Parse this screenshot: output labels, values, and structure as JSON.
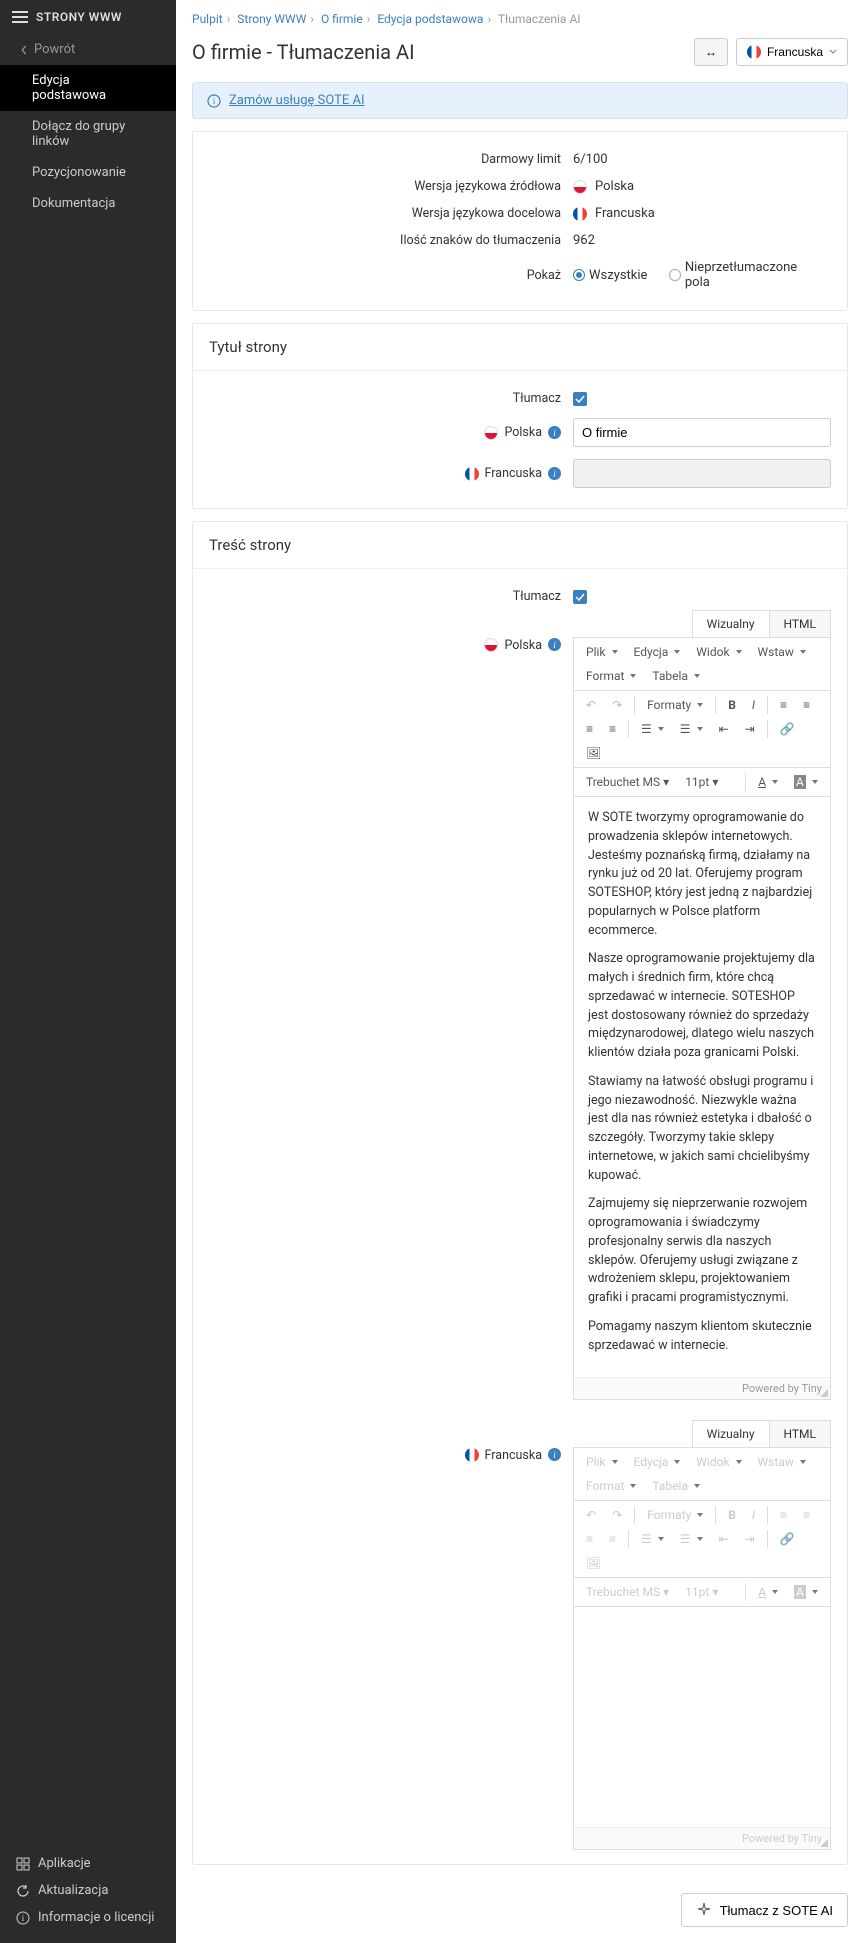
{
  "sidebar": {
    "title": "STRONY WWW",
    "back": "Powrót",
    "items": [
      {
        "label": "Edycja podstawowa",
        "active": true
      },
      {
        "label": "Dołącz do grupy linków"
      },
      {
        "label": "Pozycjonowanie"
      },
      {
        "label": "Dokumentacja"
      }
    ],
    "footer": [
      {
        "label": "Aplikacje"
      },
      {
        "label": "Aktualizacja"
      },
      {
        "label": "Informacje o licencji"
      }
    ]
  },
  "breadcrumb": {
    "items": [
      "Pulpit",
      "Strony WWW",
      "O firmie",
      "Edycja podstawowa"
    ],
    "current": "Tłumaczenia AI"
  },
  "page": {
    "title": "O firmie - Tłumaczenia AI",
    "swap_icon": "↔",
    "lang_selected": "Francuska"
  },
  "banner": {
    "text": "Zamów usługę SOTE AI"
  },
  "summary": {
    "free_limit_label": "Darmowy limit",
    "free_limit_value": "6/100",
    "source_label": "Wersja językowa źródłowa",
    "source_value": "Polska",
    "target_label": "Wersja językowa docelowa",
    "target_value": "Francuska",
    "chars_label": "Ilość znaków do tłumaczenia",
    "chars_value": "962",
    "show_label": "Pokaż",
    "radio_all": "Wszystkie",
    "radio_untranslated": "Nieprzetłumaczone pola"
  },
  "title_section": {
    "heading": "Tytuł strony",
    "translate_label": "Tłumacz",
    "polska_label": "Polska",
    "polska_value": "O firmie",
    "francuska_label": "Francuska",
    "francuska_value": ""
  },
  "content_section": {
    "heading": "Treść strony",
    "translate_label": "Tłumacz",
    "polska_label": "Polska",
    "francuska_label": "Francuska",
    "tabs": {
      "visual": "Wizualny",
      "html": "HTML"
    },
    "toolbar": {
      "file": "Plik",
      "edit": "Edycja",
      "view": "Widok",
      "insert": "Wstaw",
      "format": "Format",
      "table": "Tabela",
      "formats": "Formaty",
      "font": "Trebuchet MS",
      "size": "11pt"
    },
    "content_pl": [
      "W SOTE tworzymy oprogramowanie do prowadzenia sklepów internetowych. Jesteśmy poznańską firmą, działamy na rynku już od 20 lat. Oferujemy program SOTESHOP, który jest jedną z najbardziej popularnych w Polsce platform ecommerce.",
      "Nasze oprogramowanie projektujemy dla małych i średnich firm, które chcą sprzedawać w internecie. SOTESHOP jest dostosowany również do sprzedaży międzynarodowej, dlatego wielu naszych klientów działa poza granicami Polski.",
      "Stawiamy na łatwość obsługi programu i jego niezawodność. Niezwykle ważna jest dla nas również estetyka i dbałość o szczegóły. Tworzymy takie sklepy internetowe, w jakich sami chcielibyśmy kupować.",
      "Zajmujemy się nieprzerwanie rozwojem oprogramowania i świadczymy profesjonalny serwis dla naszych sklepów. Oferujemy usługi związane z wdrożeniem sklepu, projektowaniem grafiki i pracami programistycznymi.",
      "Pomagamy naszym klientom skutecznie sprzedawać w internecie."
    ],
    "powered": "Powered by Tiny"
  },
  "action": {
    "translate_btn": "Tłumacz z SOTE AI"
  }
}
